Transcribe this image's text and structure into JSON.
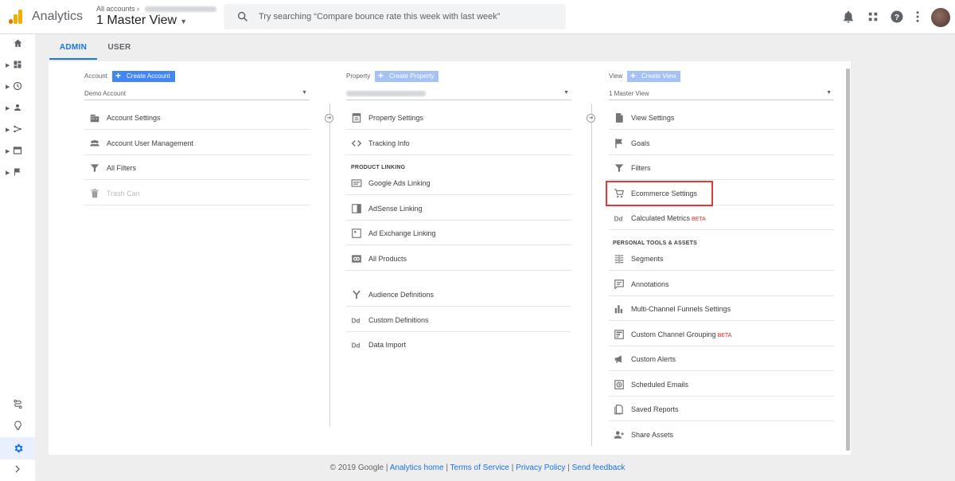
{
  "header": {
    "app_title": "Analytics",
    "all_accounts": "All accounts",
    "view_name": "1 Master View",
    "search_placeholder": "Try searching “Compare bounce rate this week with last week”"
  },
  "tabs": {
    "admin": "ADMIN",
    "user": "USER"
  },
  "account": {
    "label": "Account",
    "create": "Create Account",
    "selected": "Demo Account",
    "items": [
      "Account Settings",
      "Account User Management",
      "All Filters",
      "Trash Can"
    ]
  },
  "property": {
    "label": "Property",
    "create": "Create Property",
    "items": [
      "Property Settings",
      "Tracking Info"
    ],
    "section": "PRODUCT LINKING",
    "linking": [
      "Google Ads Linking",
      "AdSense Linking",
      "Ad Exchange Linking",
      "All Products"
    ],
    "more": [
      "Audience Definitions",
      "Custom Definitions",
      "Data Import"
    ]
  },
  "view": {
    "label": "View",
    "create": "Create View",
    "selected": "1 Master View",
    "items": [
      "View Settings",
      "Goals",
      "Filters",
      "Ecommerce Settings",
      "Calculated Metrics"
    ],
    "beta": "BETA",
    "section": "PERSONAL TOOLS & ASSETS",
    "tools": [
      "Segments",
      "Annotations",
      "Multi-Channel Funnels Settings",
      "Custom Channel Grouping",
      "Custom Alerts",
      "Scheduled Emails",
      "Saved Reports",
      "Share Assets"
    ]
  },
  "footer": {
    "copyright": "© 2019 Google",
    "links": [
      "Analytics home",
      "Terms of Service",
      "Privacy Policy",
      "Send feedback"
    ],
    "separator": "|"
  },
  "colors": {
    "accent": "#1a73e8",
    "highlight_border": "#e53935",
    "beta": "#d93025"
  }
}
